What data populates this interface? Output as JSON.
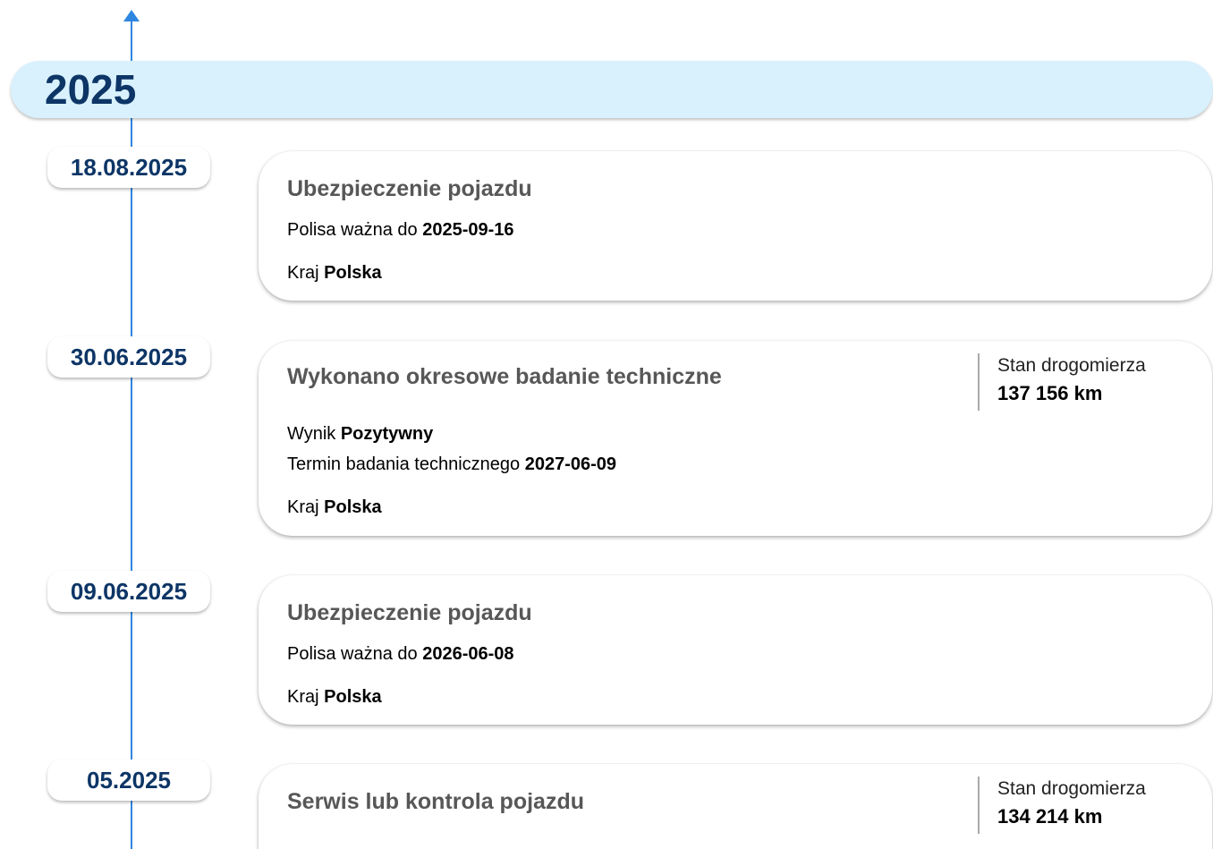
{
  "timeline": {
    "year": "2025",
    "entries": [
      {
        "date": "18.08.2025",
        "title": "Ubezpieczenie pojazdu",
        "lines": [
          {
            "label": "Polisa ważna do",
            "value": "2025-09-16"
          },
          {
            "label": "Kraj",
            "value": "Polska"
          }
        ]
      },
      {
        "date": "30.06.2025",
        "title": "Wykonano okresowe badanie techniczne",
        "odometer": {
          "label": "Stan drogomierza",
          "value": "137 156 km"
        },
        "lines": [
          {
            "label": "Wynik",
            "value": "Pozytywny"
          },
          {
            "label": "Termin badania technicznego",
            "value": "2027-06-09"
          },
          {
            "label": "Kraj",
            "value": "Polska"
          }
        ]
      },
      {
        "date": "09.06.2025",
        "title": "Ubezpieczenie pojazdu",
        "lines": [
          {
            "label": "Polisa ważna do",
            "value": "2026-06-08"
          },
          {
            "label": "Kraj",
            "value": "Polska"
          }
        ]
      },
      {
        "date": "05.2025",
        "title": "Serwis lub kontrola pojazdu",
        "odometer": {
          "label": "Stan drogomierza",
          "value": "134 214 km"
        }
      }
    ]
  },
  "colors": {
    "accent_line": "#2f86e0",
    "year_bar_bg": "#d9f1fd",
    "date_text": "#0d3566",
    "title_text": "#575757"
  }
}
